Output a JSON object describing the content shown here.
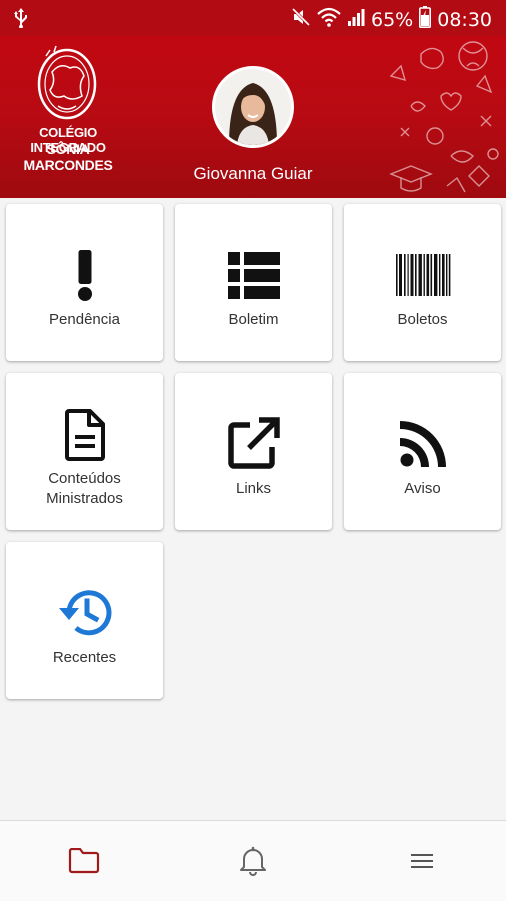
{
  "status_bar": {
    "battery": "65%",
    "time": "08:30",
    "icons": [
      "usb-icon",
      "mute-icon",
      "wifi-icon",
      "signal-icon",
      "battery-icon"
    ]
  },
  "header": {
    "logo_line1": "COLÉGIO INTEGRADO",
    "logo_line2": "SÔNIA MARCONDES",
    "user_name": "Giovanna Guiar"
  },
  "menu": [
    {
      "label": "Pendência",
      "icon": "exclamation-icon"
    },
    {
      "label": "Boletim",
      "icon": "list-icon"
    },
    {
      "label": "Boletos",
      "icon": "barcode-icon"
    },
    {
      "label_line1": "Conteúdos",
      "label_line2": "Ministrados",
      "icon": "document-icon"
    },
    {
      "label": "Links",
      "icon": "open-in-new-icon"
    },
    {
      "label": "Aviso",
      "icon": "rss-icon"
    },
    {
      "label": "Recentes",
      "icon": "history-icon"
    }
  ],
  "bottom_nav": [
    {
      "icon": "folder-icon",
      "active": true
    },
    {
      "icon": "bell-icon",
      "active": false
    },
    {
      "icon": "hamburger-menu-icon",
      "active": false
    }
  ],
  "colors": {
    "brand_red": "#b30b13",
    "recent_blue": "#1e78d6",
    "folder_red": "#a11a1a"
  }
}
